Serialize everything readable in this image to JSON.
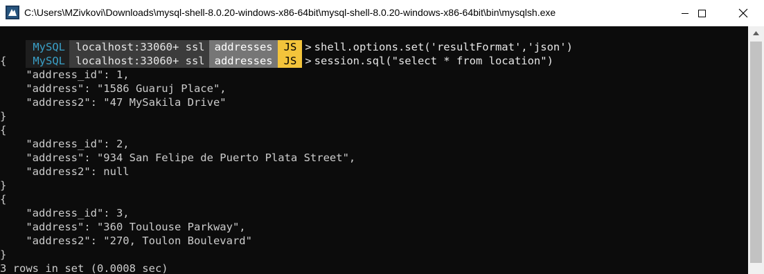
{
  "window": {
    "title": "C:\\Users\\MZivkovi\\Downloads\\mysql-shell-8.0.20-windows-x86-64bit\\mysql-shell-8.0.20-windows-x86-64bit\\bin\\mysqlsh.exe"
  },
  "prompt": {
    "product": "MySQL",
    "host": "localhost:33060+ ssl",
    "schema": "addresses",
    "mode": "JS",
    "arrow": ">"
  },
  "commands": [
    "shell.options.set('resultFormat','json')",
    "session.sql(\"select * from location\")"
  ],
  "output": [
    "{",
    "    \"address_id\": 1,",
    "    \"address\": \"1586 Guaruj Place\",",
    "    \"address2\": \"47 MySakila Drive\"",
    "}",
    "{",
    "    \"address_id\": 2,",
    "    \"address\": \"934 San Felipe de Puerto Plata Street\",",
    "    \"address2\": null",
    "}",
    "{",
    "    \"address_id\": 3,",
    "    \"address\": \"360 Toulouse Parkway\",",
    "    \"address2\": \"270, Toulon Boulevard\"",
    "}",
    "3 rows in set (0.0008 sec)"
  ],
  "colors": {
    "console_bg": "#0c0c0c",
    "mysql_blue": "#3aa0c8",
    "mode_yellow": "#f3c43b"
  },
  "icons": {
    "app": "mysql-shell-icon",
    "minimize": "minimize-icon",
    "maximize": "maximize-icon",
    "close": "close-icon"
  }
}
